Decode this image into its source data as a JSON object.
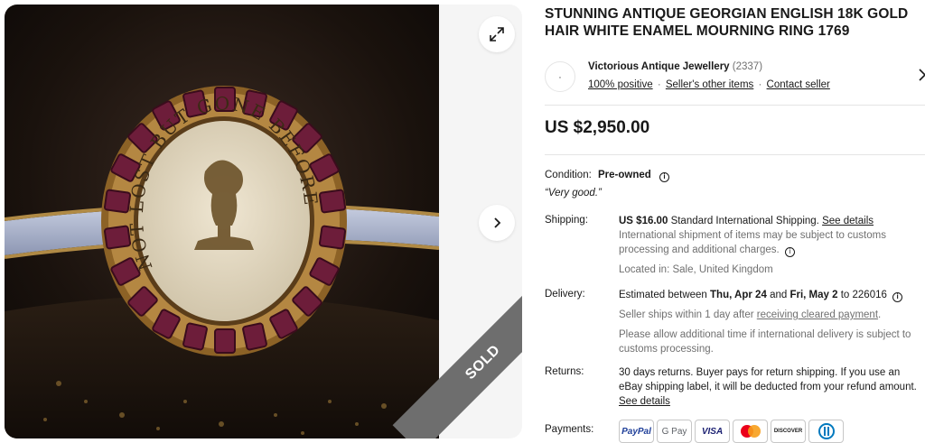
{
  "gallery": {
    "ring_inscription": "NOT LOST BUT GONE BEFORE",
    "sold_label": "SOLD",
    "expand_icon": "expand-icon",
    "next_icon": "chevron-right-icon"
  },
  "listing": {
    "title": "STUNNING ANTIQUE GEORGIAN ENGLISH 18K GOLD HAIR WHITE ENAMEL MOURNING RING 1769",
    "price": "US $2,950.00"
  },
  "seller": {
    "name": "Victorious Antique Jewellery",
    "feedback_count": "(2337)",
    "positive": "100% positive",
    "other_items": "Seller's other items",
    "contact": "Contact seller"
  },
  "condition": {
    "label": "Condition:",
    "value": "Pre-owned",
    "note": "“Very good.”"
  },
  "shipping": {
    "label": "Shipping:",
    "cost": "US $16.00",
    "method": "Standard International Shipping.",
    "details_link": "See details",
    "note": "International shipment of items may be subject to customs processing and additional charges.",
    "location": "Located in: Sale, United Kingdom"
  },
  "delivery": {
    "label": "Delivery:",
    "estimated_prefix": "Estimated between",
    "start": "Thu, Apr 24",
    "and": "and",
    "end": "Fri, May 2",
    "to": "to 226016",
    "ships_prefix": "Seller ships within 1 day after",
    "ships_link": "receiving cleared payment",
    "ships_suffix": ".",
    "allow_note": "Please allow additional time if international delivery is subject to customs processing."
  },
  "returns": {
    "label": "Returns:",
    "text": "30 days returns. Buyer pays for return shipping. If you use an eBay shipping label, it will be deducted from your refund amount.",
    "details_link": "See details"
  },
  "payments": {
    "label": "Payments:",
    "methods": [
      "PayPal",
      "G Pay",
      "VISA",
      "Mastercard",
      "DISCOVER",
      "Diners"
    ]
  },
  "colors": {
    "accent_blue": "#3665f3",
    "sold_ribbon": "#6e6e6e",
    "text": "#191919",
    "muted": "#707070"
  }
}
